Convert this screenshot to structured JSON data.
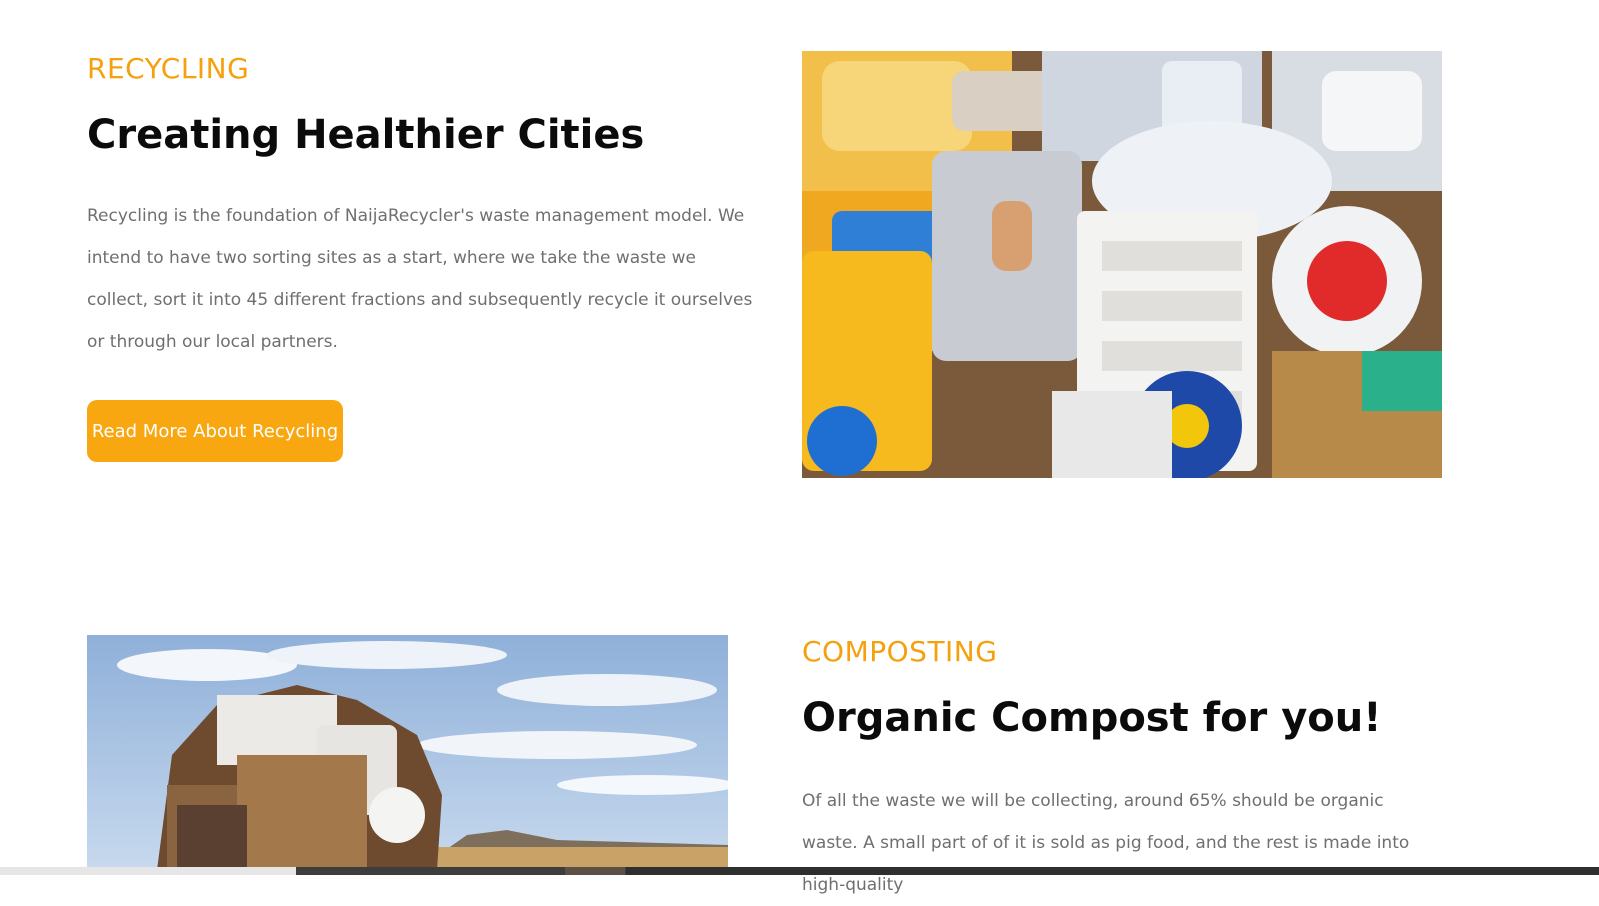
{
  "recycling": {
    "eyebrow": "RECYCLING",
    "title": "Creating Healthier Cities",
    "body": "Recycling is the foundation of NaijaRecycler's waste management model. We intend to have two sorting sites as a start, where we take the waste we collect, sort it into 45 different fractions and subsequently recycle it ourselves or through our local partners.",
    "button_label": "Read More About Recycling",
    "image_alt": "plastic-waste-photo"
  },
  "composting": {
    "eyebrow": "COMPOSTING",
    "title": "Organic Compost for you!",
    "body": "Of all the waste we will be collecting, around 65% should be organic waste. A small part of of it is sold as pig food, and the rest is made into high-quality",
    "image_alt": "scrap-pile-photo"
  },
  "colors": {
    "accent": "#f9a710",
    "heading": "#0b0b0b",
    "body": "#6f6f6f"
  }
}
